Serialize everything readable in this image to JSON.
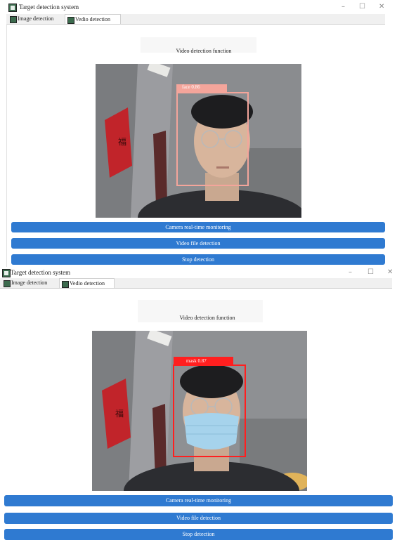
{
  "windows": [
    {
      "title": "Target detection system",
      "window_controls": {
        "minimize": "–",
        "maximize": "☐",
        "close": "✕"
      },
      "tabs": [
        {
          "label": "Image detection",
          "active": false
        },
        {
          "label": "Vedio detection",
          "active": true
        }
      ],
      "function_label": "Video detection function",
      "detection": {
        "label": "face",
        "score": "0.86",
        "color": "#f4a59b"
      },
      "buttons": {
        "camera": "Camera real-time monitoring",
        "video_file": "Video file detection",
        "stop": "Stop detection"
      }
    },
    {
      "title": "Target detection system",
      "window_controls": {
        "minimize": "–",
        "maximize": "☐",
        "close": "✕"
      },
      "tabs": [
        {
          "label": "Image detection",
          "active": false
        },
        {
          "label": "Vedio detection",
          "active": true
        }
      ],
      "function_label": "Video detection function",
      "detection": {
        "label": "mask",
        "score": "0.87",
        "color": "#ff1f1f"
      },
      "buttons": {
        "camera": "Camera real-time monitoring",
        "video_file": "Video file detection",
        "stop": "Stop detection"
      }
    }
  ],
  "colors": {
    "button": "#2f7ad1",
    "tabbar": "#f0f0f0"
  }
}
